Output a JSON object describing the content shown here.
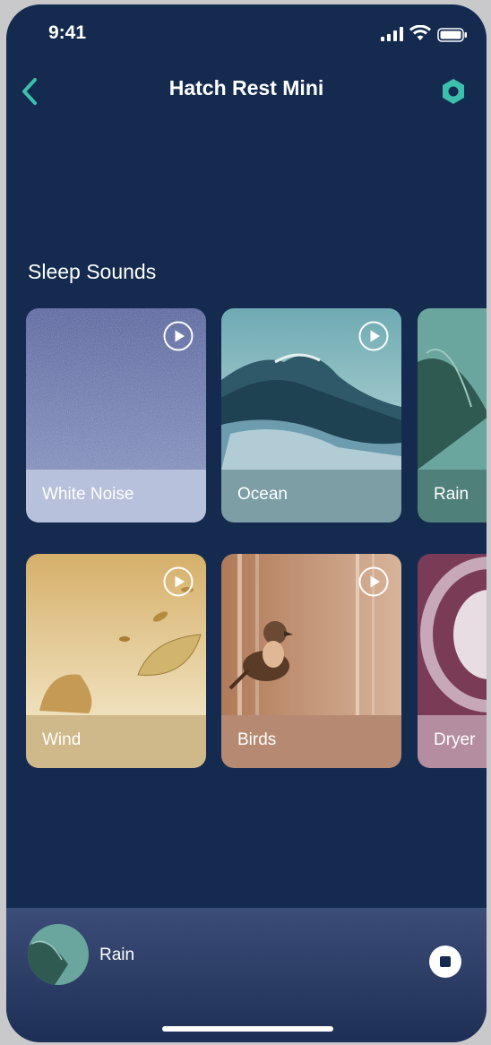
{
  "status_bar": {
    "time": "9:41"
  },
  "header": {
    "title": "Hatch Rest Mini"
  },
  "section": {
    "title": "Sleep Sounds"
  },
  "sounds": [
    {
      "label": "White Noise"
    },
    {
      "label": "Ocean"
    },
    {
      "label": "Rain"
    },
    {
      "label": "Wind"
    },
    {
      "label": "Birds"
    },
    {
      "label": "Dryer"
    }
  ],
  "now_playing": {
    "title": "Rain"
  },
  "colors": {
    "background": "#142a4f",
    "accent": "#3dbfad"
  }
}
